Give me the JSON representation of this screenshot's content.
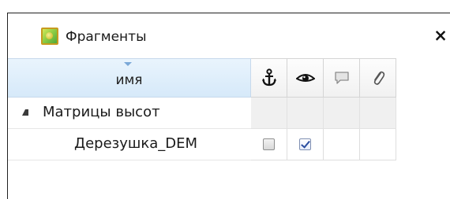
{
  "panel": {
    "title": "Фрагменты",
    "title_icon": "map-layers-icon",
    "close_label": "×"
  },
  "table": {
    "name_header": "имя",
    "column_icons": [
      "anchor-icon",
      "eye-icon",
      "comment-icon",
      "paperclip-icon"
    ],
    "group": {
      "label": "Матрицы высот",
      "expanded": true
    },
    "items": [
      {
        "label": "Дерезушка_DEM",
        "anchor_checked": false,
        "visible_checked": true
      }
    ]
  },
  "colors": {
    "header_selected": "#d6e9f9",
    "group_row_cell": "#f0f0f0",
    "checkmark": "#2a4ea0"
  }
}
